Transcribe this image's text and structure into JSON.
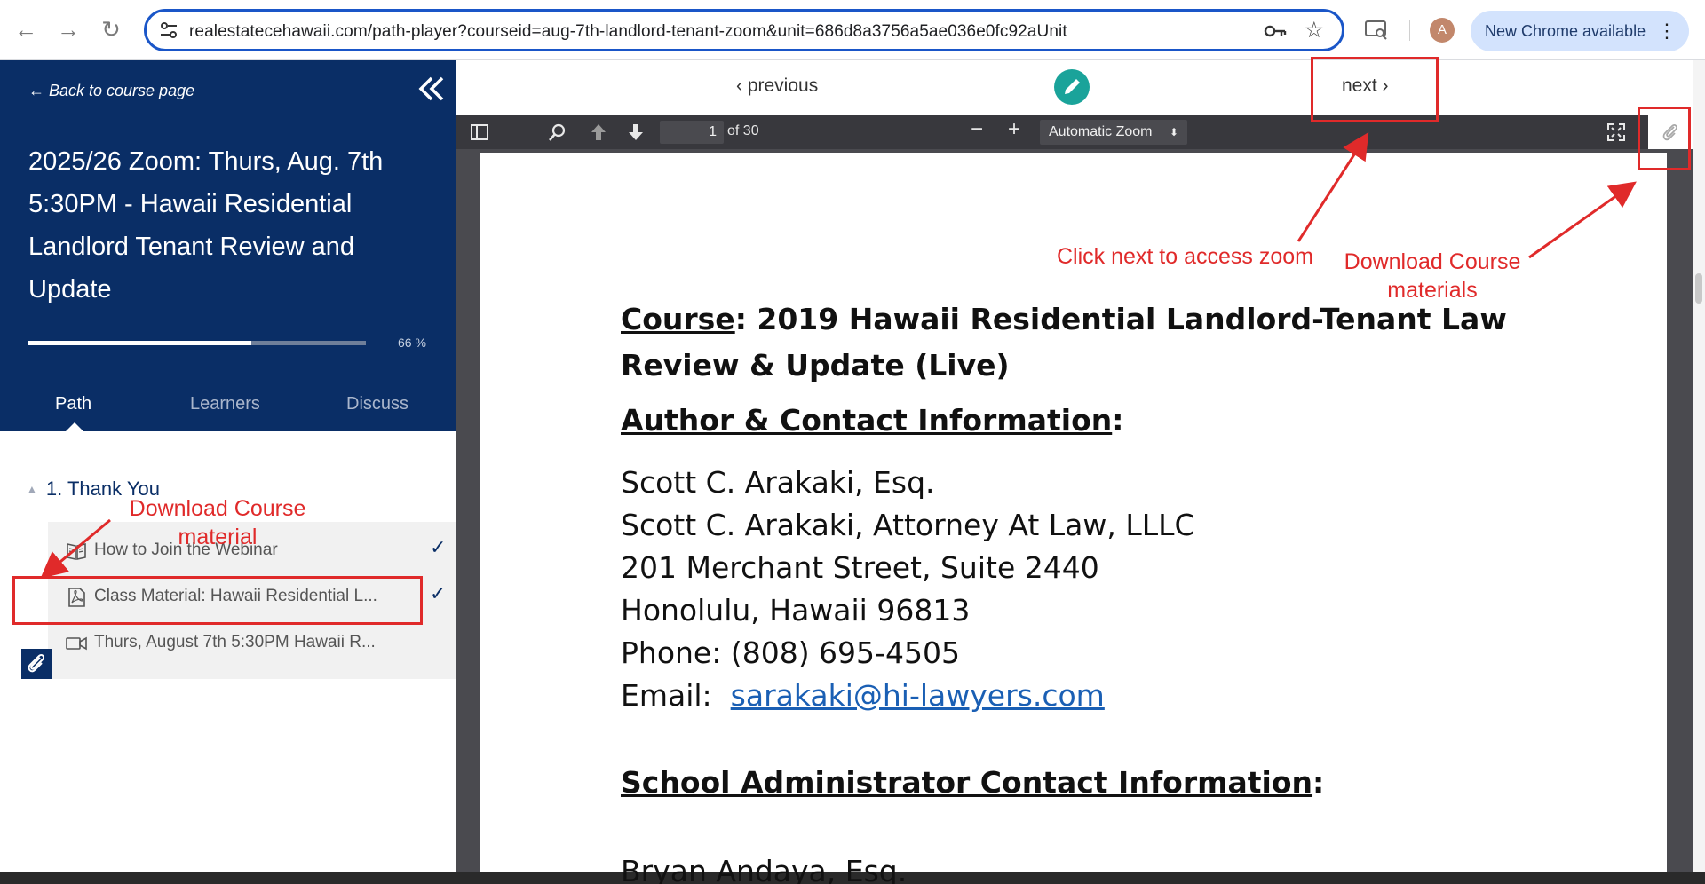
{
  "browser": {
    "url": "realestatecehawaii.com/path-player?courseid=aug-7th-landlord-tenant-zoom&unit=686d8a3756a5ae036e0fc92aUnit",
    "back_glyph": "←",
    "forward_glyph": "→",
    "reload_glyph": "↻",
    "bookmark_glyph": "☆",
    "avatar_letter": "A",
    "update_label": "New Chrome available",
    "menu_glyph": "⋮"
  },
  "sidebar": {
    "back_link": "← Back to course page",
    "course_title": "2025/26 Zoom: Thurs, Aug. 7th 5:30PM - Hawaii Residential Landlord Tenant Review and Update",
    "progress_percent": 66,
    "progress_label": "66 %",
    "tabs": [
      {
        "label": "Path",
        "active": true
      },
      {
        "label": "Learners",
        "active": false
      },
      {
        "label": "Discuss",
        "active": false
      }
    ],
    "section": {
      "caret": "▲",
      "title": "1. Thank You"
    },
    "lessons": [
      {
        "icon": "book-icon",
        "label": "How to Join the Webinar",
        "check": "✓"
      },
      {
        "icon": "pdf-icon",
        "label": "Class Material: Hawaii Residential L...",
        "check": "✓"
      },
      {
        "icon": "video-icon",
        "label": "Thurs, August 7th 5:30PM Hawaii R...",
        "check": ""
      }
    ]
  },
  "viewer": {
    "previous_label": "‹ previous",
    "next_label": "next ›",
    "page_number": "1",
    "page_total": "of 30",
    "zoom_label": "Automatic Zoom",
    "zoom_arrows": "⬍",
    "zoom_out": "−",
    "zoom_in": "+"
  },
  "document": {
    "course_label": "Course",
    "course_text": ":  2019 Hawaii Residential Landlord-Tenant Law Review & Update (Live)",
    "author_heading": "Author & Contact Information",
    "colon": ":",
    "lines": [
      "Scott C. Arakaki, Esq.",
      "Scott C. Arakaki, Attorney At Law, LLLC",
      "201 Merchant Street, Suite 2440",
      "Honolulu, Hawaii 96813",
      "Phone:  (808) 695-4505"
    ],
    "email_label": "Email:  ",
    "email_link": "sarakaki@hi-lawyers.com",
    "school_heading": "School Administrator Contact Information",
    "cut_line": "Bryan Andaya, Esq."
  },
  "annotations": {
    "next_note": "Click next to access zoom",
    "download_note": "Download Course materials",
    "download_course_note": "Download Course material",
    "color": "#e02a2a"
  }
}
